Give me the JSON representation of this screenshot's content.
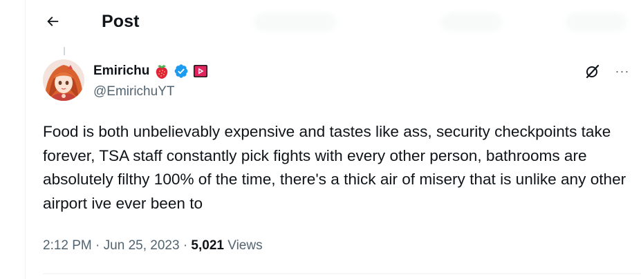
{
  "header": {
    "title": "Post",
    "back_icon": "arrow-left-icon"
  },
  "author": {
    "display_name": "Emirichu",
    "emoji": "🍓",
    "handle": "@EmirichuYT",
    "verified_color": "#1d9bf0",
    "youtube_color": "#e0245e"
  },
  "tweet": {
    "text": "Food is both unbelievably expensive and tastes like ass, security checkpoints take forever, TSA staff constantly pick fights with every other person, bathrooms are absolutely filthy 100% of the time, there's a thick air of misery that is unlike any other airport ive ever been to"
  },
  "meta": {
    "time": "2:12 PM",
    "separator": "·",
    "date": "Jun 25, 2023",
    "views_count": "5,021",
    "views_label": "Views"
  },
  "actions": {
    "more_label": "···"
  },
  "colors": {
    "text": "#0f1419",
    "secondary": "#536471",
    "border": "#eff3f4",
    "accent": "#1d9bf0"
  }
}
